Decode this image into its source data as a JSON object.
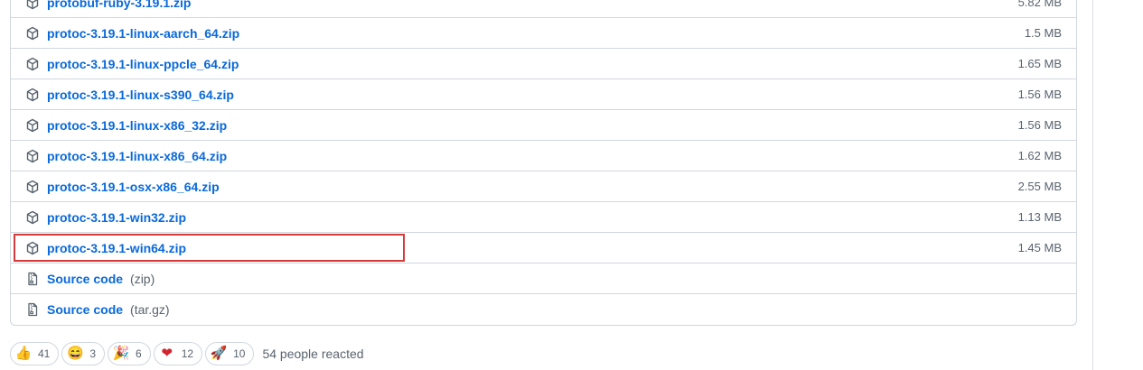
{
  "assets": [
    {
      "name": "protobuf-ruby-3.19.1.zip",
      "size": "5.82 MB",
      "icon": "package-icon"
    },
    {
      "name": "protoc-3.19.1-linux-aarch_64.zip",
      "size": "1.5 MB",
      "icon": "package-icon"
    },
    {
      "name": "protoc-3.19.1-linux-ppcle_64.zip",
      "size": "1.65 MB",
      "icon": "package-icon"
    },
    {
      "name": "protoc-3.19.1-linux-s390_64.zip",
      "size": "1.56 MB",
      "icon": "package-icon"
    },
    {
      "name": "protoc-3.19.1-linux-x86_32.zip",
      "size": "1.56 MB",
      "icon": "package-icon"
    },
    {
      "name": "protoc-3.19.1-linux-x86_64.zip",
      "size": "1.62 MB",
      "icon": "package-icon"
    },
    {
      "name": "protoc-3.19.1-osx-x86_64.zip",
      "size": "2.55 MB",
      "icon": "package-icon"
    },
    {
      "name": "protoc-3.19.1-win32.zip",
      "size": "1.13 MB",
      "icon": "package-icon"
    },
    {
      "name": "protoc-3.19.1-win64.zip",
      "size": "1.45 MB",
      "icon": "package-icon",
      "highlighted": true
    }
  ],
  "source_code": [
    {
      "label": "Source code",
      "ext": "(zip)",
      "icon": "file-zip-icon"
    },
    {
      "label": "Source code",
      "ext": "(tar.gz)",
      "icon": "file-zip-icon"
    }
  ],
  "reactions": [
    {
      "emoji": "👍",
      "count": "41",
      "icon": "thumbs-up-icon"
    },
    {
      "emoji": "😄",
      "count": "3",
      "icon": "laugh-icon"
    },
    {
      "emoji": "🎉",
      "count": "6",
      "icon": "hooray-icon"
    },
    {
      "emoji": "❤",
      "count": "12",
      "icon": "heart-icon"
    },
    {
      "emoji": "🚀",
      "count": "10",
      "icon": "rocket-icon"
    }
  ],
  "reactions_summary": "54 people reacted",
  "colors": {
    "link": "#0969da",
    "muted": "#59636e",
    "border": "#d0d7de",
    "highlight": "#d73a3a"
  }
}
